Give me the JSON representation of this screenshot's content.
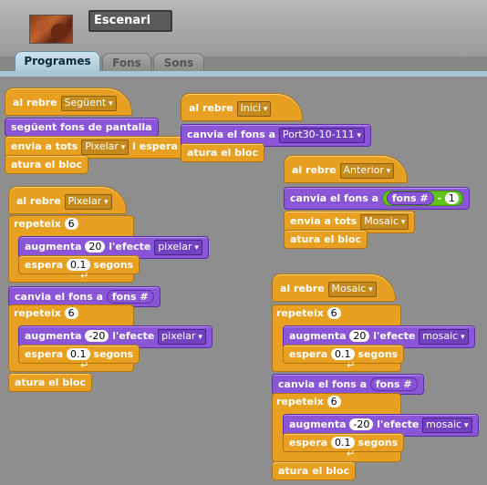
{
  "sprite": {
    "name": "Escenari"
  },
  "tabs": {
    "t0": "Programes",
    "t1": "Fons",
    "t2": "Sons"
  },
  "s1": {
    "hat": "al rebre",
    "hat_msg": "Següent",
    "b1": "següent fons de pantalla",
    "b2a": "envia a tots",
    "b2msg": "Pixelar",
    "b2b": "i espera",
    "b3": "atura el bloc"
  },
  "s2": {
    "hat": "al rebre",
    "hat_msg": "Inici",
    "b1": "canvia el fons a",
    "b1v": "Port30-10-111",
    "b2": "atura el bloc"
  },
  "s3": {
    "hat": "al rebre",
    "hat_msg": "Anterior",
    "b1": "canvia el fons a",
    "r1": "fons #",
    "r2": "-",
    "r3": "1",
    "b2": "envia a tots",
    "b2msg": "Mosaic",
    "b3": "atura el bloc"
  },
  "s4": {
    "hat": "al rebre",
    "hat_msg": "Pixelar",
    "rep1": "repeteix",
    "rep1n": "6",
    "a1": "augmenta",
    "a1n": "20",
    "a1e": "l'efecte",
    "a1v": "pixelar",
    "w1": "espera",
    "w1n": "0.1",
    "w1s": "segons",
    "c1": "canvia el fons a",
    "c1r": "fons #",
    "rep2": "repeteix",
    "rep2n": "6",
    "a2": "augmenta",
    "a2n": "-20",
    "a2e": "l'efecte",
    "a2v": "pixelar",
    "w2": "espera",
    "w2n": "0.1",
    "w2s": "segons",
    "end": "atura el bloc"
  },
  "s5": {
    "hat": "al rebre",
    "hat_msg": "Mosaic",
    "rep1": "repeteix",
    "rep1n": "6",
    "a1": "augmenta",
    "a1n": "20",
    "a1e": "l'efecte",
    "a1v": "mosaic",
    "w1": "espera",
    "w1n": "0.1",
    "w1s": "segons",
    "c1": "canvia el fons a",
    "c1r": "fons #",
    "rep2": "repeteix",
    "rep2n": "6",
    "a2": "augmenta",
    "a2n": "-20",
    "a2e": "l'efecte",
    "a2v": "mosaic",
    "w2": "espera",
    "w2n": "0.1",
    "w2s": "segons",
    "end": "atura el bloc"
  }
}
